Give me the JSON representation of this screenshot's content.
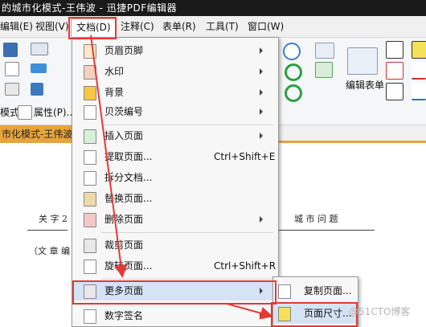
{
  "window": {
    "title": "的城市化模式-王伟波 - 迅捷PDF编辑器"
  },
  "menubar": {
    "items": [
      {
        "label": "编辑(E)"
      },
      {
        "label": "视图(V)"
      },
      {
        "label": "文档(D)"
      },
      {
        "label": "注释(C)"
      },
      {
        "label": "表单(R)"
      },
      {
        "label": "工具(T)"
      },
      {
        "label": "窗口(W)"
      }
    ]
  },
  "toolbar": {
    "mode_label": "模式",
    "properties_label": "属性(P)...",
    "form_edit_label": "编辑表单"
  },
  "document": {
    "tab_label": "市化模式-王伟波 *",
    "handwriting_left": "关 字 2",
    "handwriting_right": "城 市 问 题",
    "handwriting_body": "（文 章 编"
  },
  "doc_menu": {
    "items": [
      {
        "label": "页眉页脚",
        "icon": "header-footer-icon",
        "submenu": true
      },
      {
        "label": "水印",
        "icon": "watermark-icon",
        "submenu": true
      },
      {
        "label": "背景",
        "icon": "background-icon",
        "submenu": true
      },
      {
        "label": "贝茨编号",
        "icon": "bates-number-icon",
        "submenu": true
      },
      {
        "label": "插入页面",
        "icon": "insert-page-icon",
        "submenu": true
      },
      {
        "label": "提取页面...",
        "shortcut": "Ctrl+Shift+E",
        "icon": "extract-page-icon"
      },
      {
        "label": "拆分文档...",
        "icon": "split-document-icon"
      },
      {
        "label": "替换页面...",
        "icon": "replace-page-icon"
      },
      {
        "label": "删除页面",
        "icon": "delete-page-icon",
        "submenu": true
      },
      {
        "label": "裁剪页面",
        "icon": "crop-page-icon"
      },
      {
        "label": "旋转页面...",
        "shortcut": "Ctrl+Shift+R",
        "icon": "rotate-page-icon"
      },
      {
        "label": "更多页面",
        "icon": "more-pages-icon",
        "submenu": true
      },
      {
        "label": "数字签名",
        "icon": "digital-signature-icon",
        "submenu": true
      }
    ]
  },
  "submenu": {
    "items": [
      {
        "label": "复制页面...",
        "icon": "copy-page-icon"
      },
      {
        "label": "页面尺寸...",
        "icon": "page-size-icon"
      }
    ]
  },
  "watermark_text": "@51CTO博客",
  "colors": {
    "highlight": "#e53935",
    "tab": "#e8a43c",
    "menu_hover": "#d4e4f5"
  }
}
